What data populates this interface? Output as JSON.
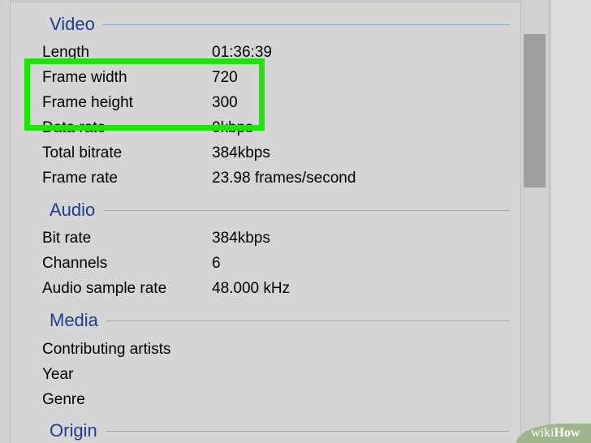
{
  "sections": {
    "video": {
      "title": "Video"
    },
    "audio": {
      "title": "Audio"
    },
    "media": {
      "title": "Media"
    },
    "origin": {
      "title": "Origin"
    }
  },
  "video_rows": [
    {
      "label": "Length",
      "value": "01:36:39"
    },
    {
      "label": "Frame width",
      "value": "720"
    },
    {
      "label": "Frame height",
      "value": "300"
    },
    {
      "label": "Data rate",
      "value": "0kbps"
    },
    {
      "label": "Total bitrate",
      "value": "384kbps"
    },
    {
      "label": "Frame rate",
      "value": "23.98 frames/second"
    }
  ],
  "audio_rows": [
    {
      "label": "Bit rate",
      "value": "384kbps"
    },
    {
      "label": "Channels",
      "value": "6"
    },
    {
      "label": "Audio sample rate",
      "value": "48.000 kHz"
    }
  ],
  "media_rows": [
    {
      "label": "Contributing artists",
      "value": ""
    },
    {
      "label": "Year",
      "value": ""
    },
    {
      "label": "Genre",
      "value": ""
    }
  ],
  "watermark": {
    "part1": "wiki",
    "part2": "How"
  },
  "colors": {
    "highlight": "#1fe40a",
    "section_title": "#1f3d8f"
  }
}
